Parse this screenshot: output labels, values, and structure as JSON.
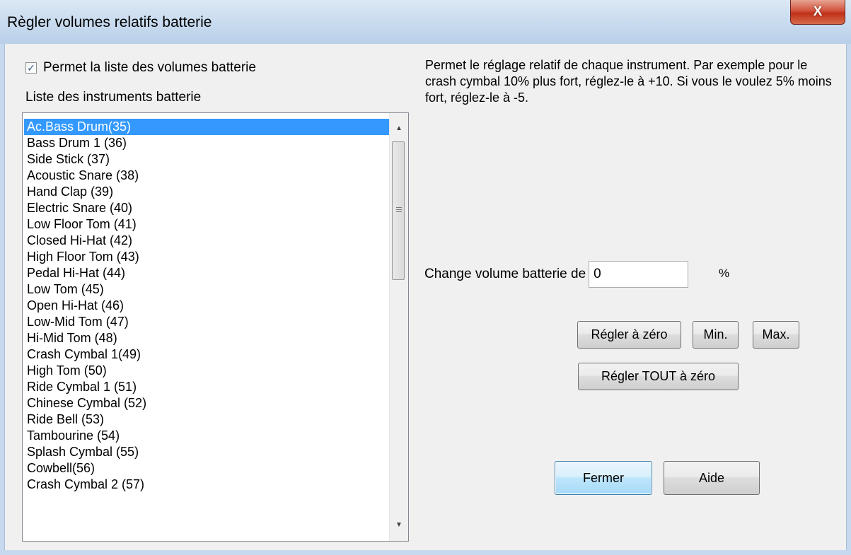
{
  "window": {
    "title": "Règler volumes relatifs batterie",
    "close_glyph": "X"
  },
  "enable_checkbox": {
    "label": "Permet la liste des volumes batterie",
    "checked": true,
    "check_glyph": "✓"
  },
  "instrument_list": {
    "caption": "Liste des instruments batterie",
    "selected_index": 0,
    "items": [
      "Ac.Bass Drum(35)",
      "Bass Drum 1 (36)",
      "Side Stick (37)",
      "Acoustic Snare (38)",
      "Hand Clap (39)",
      "Electric Snare (40)",
      "Low Floor Tom (41)",
      "Closed Hi-Hat (42)",
      "High Floor Tom (43)",
      "Pedal Hi-Hat (44)",
      "Low Tom  (45)",
      "Open Hi-Hat (46)",
      "Low-Mid Tom  (47)",
      "Hi-Mid Tom (48)",
      "Crash Cymbal 1(49)",
      "High Tom (50)",
      "Ride Cymbal 1 (51)",
      "Chinese Cymbal (52)",
      "Ride Bell (53)",
      "Tambourine (54)",
      "Splash Cymbal (55)",
      "Cowbell(56)",
      "Crash Cymbal 2 (57)"
    ]
  },
  "help_text": "Permet le réglage relatif de chaque instrument. Par exemple pour le crash cymbal 10% plus fort, réglez-le à +10. Si vous le voulez 5% moins fort, réglez-le à -5.",
  "change": {
    "label": "Change volume batterie de",
    "value": "0",
    "unit": "%"
  },
  "buttons": {
    "reset": "Régler à zéro",
    "min": "Min.",
    "max": "Max.",
    "reset_all": "Régler TOUT à zéro",
    "close": "Fermer",
    "help": "Aide"
  },
  "colors": {
    "selection": "#3399ff",
    "close_button": "#c9442b",
    "titlebar": "#c6d9ee"
  }
}
